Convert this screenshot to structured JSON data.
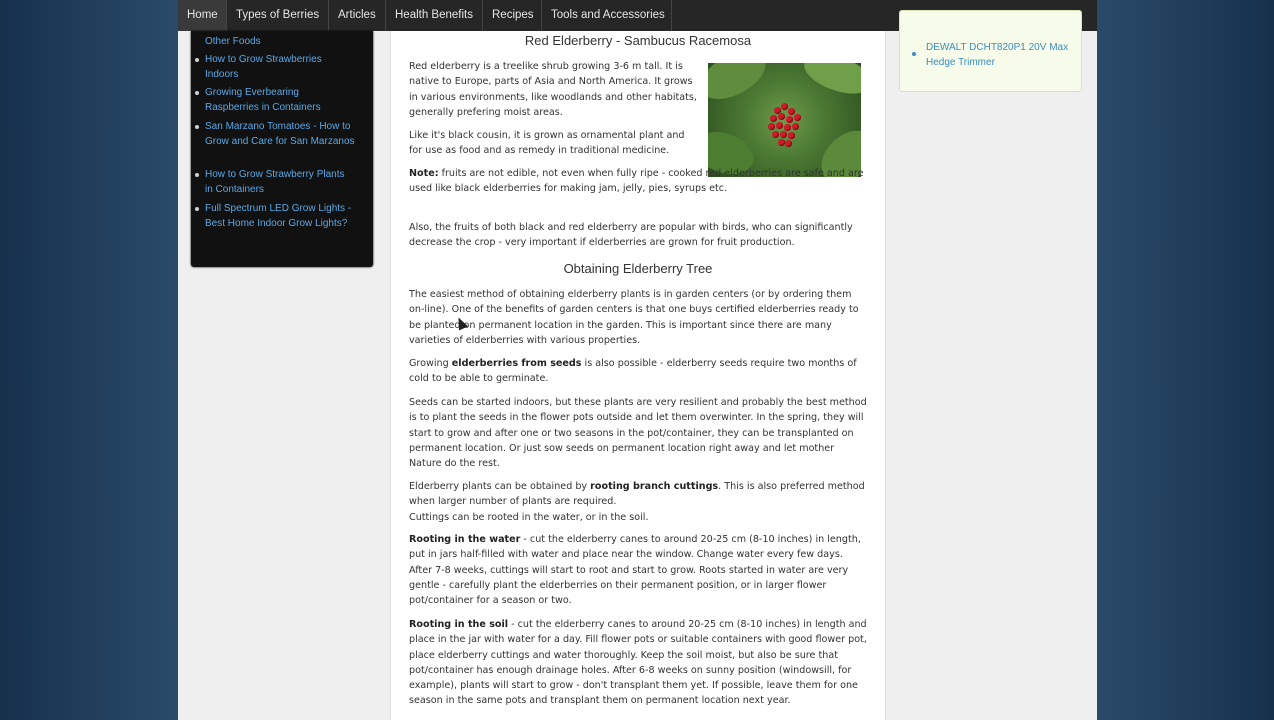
{
  "nav": {
    "items": [
      "Home",
      "Types of Berries",
      "Articles",
      "Health Benefits",
      "Recipes",
      "Tools and Accessories"
    ]
  },
  "sidebar_left": {
    "items": [
      "Other Foods",
      "How to Grow Strawberries Indoors",
      "Growing Everbearing Raspberries in Containers",
      "San Marzano Tomatoes - How to Grow and Care for San Marzanos",
      "How to Grow Strawberry Plants in Containers",
      "Full Spectrum LED Grow Lights - Best Home Indoor Grow Lights?"
    ]
  },
  "sidebar_right": {
    "items": [
      "DEWALT DCHT820P1 20V Max Hedge Trimmer"
    ]
  },
  "content": {
    "heading1": "Red Elderberry - Sambucus Racemosa",
    "p1": "Red elderberry is a treelike shrub growing 3-6 m tall. It is native to Europe, parts of Asia and North America. It grows in various environments, like woodlands and other habitats, generally prefering moist areas.",
    "p2": "Like it's black cousin, it is grown as ornamental plant and for use as food and as remedy in traditional medicine.",
    "p3_label": "Note:",
    "p3": " fruits are not edible, not even when fully ripe - cooked red elderberries are safe and are used like black elderberries for making jam, jelly, pies, syrups etc.",
    "p4": "Also, the fruits of both black and red elderberry are popular with birds, who can significantly decrease the crop - very important if elderberries are grown for fruit production.",
    "heading2": "Obtaining Elderberry Tree",
    "p5": "The easiest method of obtaining elderberry plants is in garden centers (or by ordering them on-line). One of the benefits of garden centers is that one buys certified elderberries ready to be planted on permanent location in the garden. This is important since there are many varieties of elderberries with various properties.",
    "p6_a": "Growing ",
    "p6_b": "elderberries from seeds",
    "p6_c": " is also possible - elderberry seeds require two months of cold to be able to germinate.",
    "p7": "Seeds can be started indoors, but these plants are very resilient and probably the best method is to plant the seeds in the flower pots outside and let them overwinter. In the spring, they will start to grow and after one or two seasons in the pot/container, they can be transplanted on permanent location. Or just sow seeds on permanent location right away and let mother Nature do the rest.",
    "p8_a": "Elderberry plants can be obtained by ",
    "p8_b": "rooting branch cuttings",
    "p8_c": ". This is also preferred method when larger number of plants are required.",
    "p8_d": "Cuttings can be rooted in the water, or in the soil.",
    "p9_label": "Rooting in the water",
    "p9": " - cut the elderberry canes to around 20-25 cm (8-10 inches) in length, put in jars half-filled with water and place near the window. Change water every few days. After 7-8 weeks, cuttings will start to root and start to grow. Roots started in water are very gentle - carefully plant the elderberries on their permanent position, or in larger flower pot/container for a season or two.",
    "p10_label": "Rooting in the soil",
    "p10": " - cut the elderberry canes to around 20-25 cm (8-10 inches) in length and place in the jar with water for a day. Fill flower pots or suitable containers with good flower pot, place elderberry cuttings and water thoroughly. Keep the soil moist, but also be sure that pot/container has enough drainage holes. After 6-8 weeks on sunny position (windowsill, for example), plants will start to grow - don't transplant them yet. If possible, leave them for one season in the same pots and transplant them on permanent location next year."
  }
}
